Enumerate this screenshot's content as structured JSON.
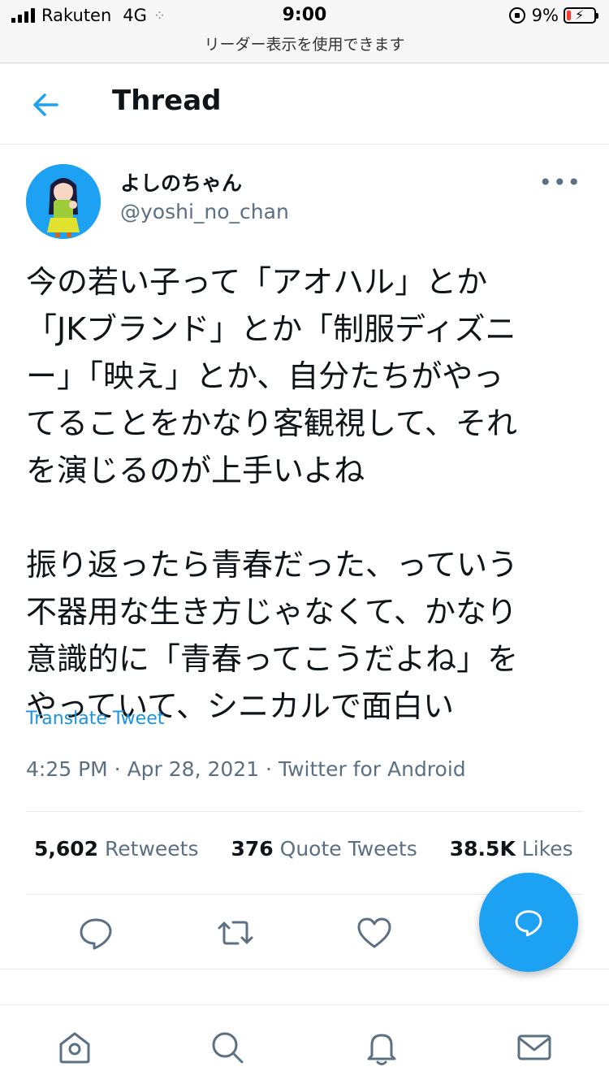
{
  "status_bar": {
    "carrier": "Rakuten",
    "network": "4G",
    "time": "9:00",
    "battery": "9%",
    "reader_notice": "リーダー表示を使用できます"
  },
  "header": {
    "title": "Thread",
    "back_icon": "arrow-left-icon"
  },
  "tweet": {
    "author_name": "よしのちゃん",
    "author_handle": "@yoshi_no_chan",
    "more_icon": "more-horizontal-icon",
    "text": "今の若い子って「アオハル」とか\n「JKブランド」とか「制服ディズニ\nー」「映え」とか、自分たちがやっ\nてることをかなり客観視して、それ\nを演じるのが上手いよね\n\n振り返ったら青春だった、っていう\n不器用な生き方じゃなくて、かなり\n意識的に「青春ってこうだよね」を\nやっていて、シニカルで面白い",
    "translate_label": "Translate Tweet",
    "meta": "4:25 PM · Apr 28, 2021 · Twitter for Android"
  },
  "stats": {
    "retweets_count": "5,602",
    "retweets_label": "Retweets",
    "quotes_count": "376",
    "quotes_label": "Quote Tweets",
    "likes_count": "38.5K",
    "likes_label": "Likes"
  },
  "actions": [
    "reply-icon",
    "retweet-icon",
    "like-icon"
  ],
  "fab_icon": "compose-reply-icon",
  "tabbar": [
    "home-icon",
    "search-icon",
    "notifications-icon",
    "messages-icon"
  ],
  "colors": {
    "accent": "#1da1f2",
    "text_primary": "#0f1419",
    "text_secondary": "#5b7083",
    "link": "#1b95e0"
  }
}
